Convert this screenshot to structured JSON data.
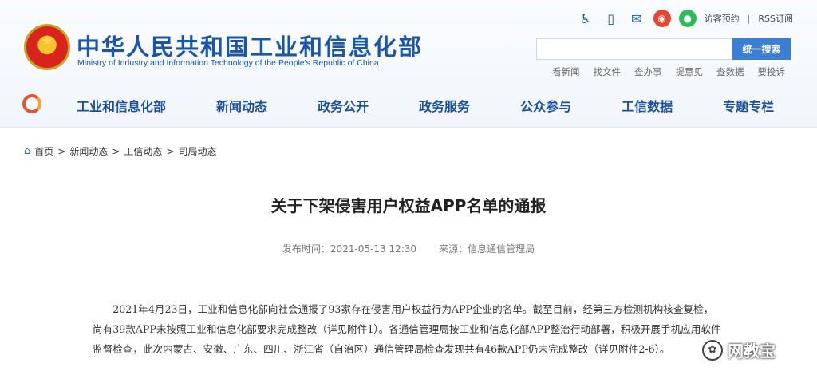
{
  "header": {
    "title": "中华人民共和国工业和信息化部",
    "subtitle": "Ministry of Industry and Information Technology of the People's Republic of China",
    "top_links": {
      "visit": "访客预约",
      "separator": "|",
      "rss": "RSS订阅"
    },
    "icons": [
      "accessibility-icon",
      "mobile-icon",
      "mail-icon",
      "weibo-icon",
      "wechat-icon"
    ],
    "search": {
      "placeholder": "",
      "button_label": "统一搜索"
    },
    "quick_links": [
      "看新闻",
      "找文件",
      "查办事",
      "提意见",
      "查数据",
      "要投诉"
    ]
  },
  "nav": {
    "items": [
      "工业和信息化部",
      "新闻动态",
      "政务公开",
      "政务服务",
      "公众参与",
      "工信数据",
      "专题专栏"
    ]
  },
  "breadcrumb": {
    "items": [
      "首页",
      "新闻动态",
      "工信动态",
      "司局动态"
    ],
    "separator": ">"
  },
  "article": {
    "title": "关于下架侵害用户权益APP名单的通报",
    "publish_time": "发布时间：2021-05-13 12:30",
    "source": "来源：信息通信管理局",
    "body": "2021年4月23日，工业和信息化部向社会通报了93家存在侵害用户权益行为APP企业的名单。截至目前，经第三方检测机构核查复检，尚有39款APP未按照工业和信息化部要求完成整改（详见附件1）。各通信管理局按工业和信息化部APP整治行动部署，积极开展手机应用软件监督检查，此次内蒙古、安徽、广东、四川、浙江省（自治区）通信管理局检查发现共有46款APP仍未完成整改（详见附件2-6）。"
  },
  "watermark": {
    "text": "网教宝"
  },
  "colors": {
    "brand": "#1b56a8",
    "search_button": "#3b7fd4"
  }
}
